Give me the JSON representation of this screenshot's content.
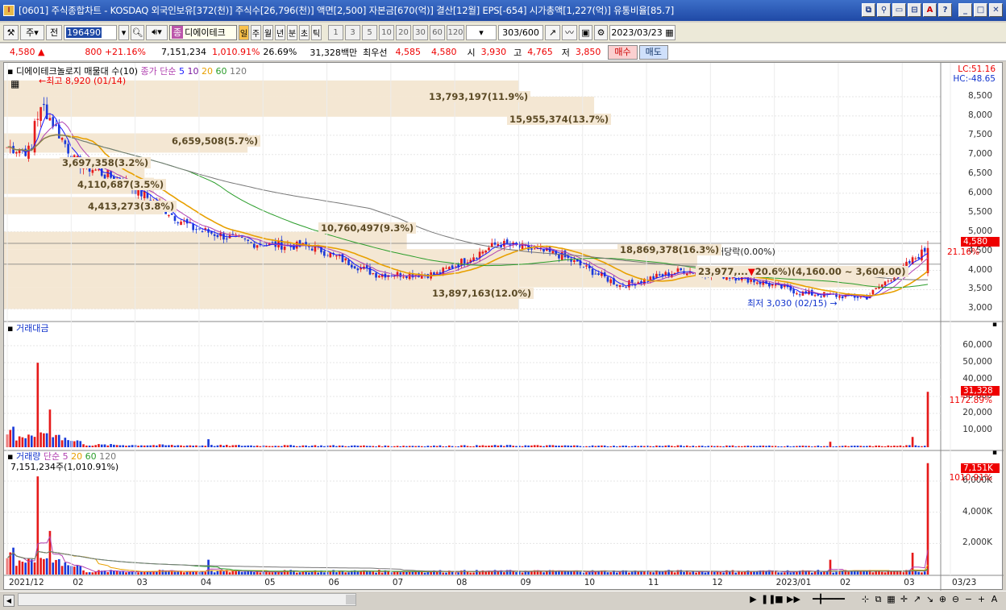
{
  "window": {
    "title": "[0601] 주식종합차트 - KOSDAQ 외국인보유[372(천)] 주식수[26,796(천)] 액면[2,500] 자본금[670(억)] 결산[12월] EPS[-654] 시가총액[1,227(억)] 유통비율[85.7]",
    "icon": "app-icon",
    "buttons": [
      "restore-window-icon",
      "link-icon",
      "window-icon",
      "split-icon",
      "pdf-icon",
      "help-icon",
      "minimize-icon",
      "maximize-icon",
      "close-icon"
    ]
  },
  "toolbar": {
    "kind": "주",
    "side": "전",
    "code": "196490",
    "stock_name": "디에이테크",
    "stock_badge": "종",
    "periods": [
      "일",
      "주",
      "월",
      "년",
      "분",
      "초",
      "틱"
    ],
    "active_period": "일",
    "intervals": [
      "1",
      "3",
      "5",
      "10",
      "20",
      "30",
      "60",
      "120"
    ],
    "count": "303",
    "count_max": "/600",
    "date": "2023/03/23"
  },
  "quote": {
    "price": "4,580",
    "change": "800",
    "change_pct": "+21.16%",
    "volume": "7,151,234",
    "volume_ratio": "1,010.91%",
    "turnover_pct": "26.69%",
    "amount": "31,328백만",
    "best_bid_label": "최우선",
    "ask": "4,585",
    "bid": "4,580",
    "open_label": "시",
    "open": "3,930",
    "high_label": "고",
    "high": "4,765",
    "low_label": "저",
    "low": "3,850",
    "buy": "매수",
    "sell": "매도"
  },
  "price_pane": {
    "legend_name": "디에이테크놀로지 매물대 수(10)",
    "legend_close": "종가 단순",
    "ma": [
      "5",
      "10",
      "20",
      "60",
      "120"
    ],
    "ma_colors": [
      "#1a1aff",
      "#7a1aa0",
      "#e8a000",
      "#2a9d2a",
      "#777777"
    ],
    "lc": "LC:51.16",
    "hc": "HC:-48.65",
    "y_ticks": [
      "8,500",
      "8,000",
      "7,500",
      "7,000",
      "6,500",
      "6,000",
      "5,500",
      "5,000",
      "4,500",
      "4,000",
      "3,500",
      "3,000"
    ],
    "current_price": "4,580",
    "current_pct": "21.16%",
    "max_note": "최고 8,920 (01/14)",
    "min_note": "최저 3,030 (02/15)",
    "dividend": "배당락(0.00%)",
    "range_note": "20.6%)(4,160.00 ~ 3,604.00)",
    "volume_profile": [
      {
        "label": "13,793,197(11.9%)"
      },
      {
        "label": "15,955,374(13.7%)"
      },
      {
        "label": "6,659,508(5.7%)"
      },
      {
        "label": "3,697,358(3.2%)"
      },
      {
        "label": "4,110,687(3.5%)"
      },
      {
        "label": "4,413,273(3.8%)"
      },
      {
        "label": "10,760,497(9.3%)"
      },
      {
        "label": "18,869,378(16.3%)"
      },
      {
        "label": "23,977,..."
      },
      {
        "label": "13,897,163(12.0%)"
      }
    ]
  },
  "amount_pane": {
    "legend": "거래대금",
    "y_ticks": [
      "60,000",
      "50,000",
      "40,000",
      "30,000",
      "20,000",
      "10,000"
    ],
    "current": "31,328",
    "current_pct": "1172.89%"
  },
  "volume_pane": {
    "legend": "거래량",
    "legend_ma": "단순 5",
    "ma": [
      "20",
      "60",
      "120"
    ],
    "value_note": "7,151,234주(1,010.91%)",
    "y_ticks": [
      "6,000K",
      "4,000K",
      "2,000K"
    ],
    "current": "7,151K",
    "current_pct": "1010.91%"
  },
  "x_axis": [
    "2021/12",
    "02",
    "03",
    "04",
    "05",
    "06",
    "07",
    "08",
    "09",
    "10",
    "11",
    "12",
    "2023/01",
    "02",
    "03",
    "03/23"
  ],
  "chart_data": {
    "type": "candlestick",
    "title": "디에이테크놀로지",
    "ylim": [
      2800,
      9000
    ],
    "months": [
      "2021/12",
      "2022/01",
      "2022/02",
      "2022/03",
      "2022/04",
      "2022/05",
      "2022/06",
      "2022/07",
      "2022/08",
      "2022/09",
      "2022/10",
      "2022/11",
      "2022/12",
      "2023/01",
      "2023/02",
      "2023/03"
    ],
    "approx_monthly_close": [
      7200,
      6900,
      6200,
      5100,
      4700,
      4600,
      3900,
      3900,
      4700,
      4400,
      3600,
      4000,
      3800,
      3400,
      3300,
      4580
    ],
    "last_ohlc": {
      "open": 3930,
      "high": 4765,
      "low": 3850,
      "close": 4580
    }
  }
}
